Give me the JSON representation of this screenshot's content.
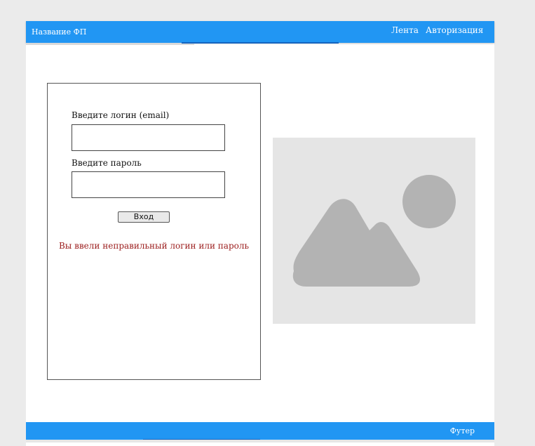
{
  "header": {
    "brand": "Название ФП",
    "nav": [
      {
        "label": "Лента"
      },
      {
        "label": "Авторизация"
      }
    ]
  },
  "login_form": {
    "login_label": "Введите логин (email)",
    "login_value": "",
    "password_label": "Введите пароль",
    "password_value": "",
    "submit_label": "Вход",
    "error_message": "Вы ввели неправильный логин или пароль"
  },
  "image": {
    "icon": "image-placeholder-icon"
  },
  "footer": {
    "text": "Футер"
  },
  "colors": {
    "header_bg": "#2196f3",
    "error_text": "#9b1c1c",
    "placeholder_bg": "#e5e5e5",
    "placeholder_shape": "#b3b3b3"
  }
}
